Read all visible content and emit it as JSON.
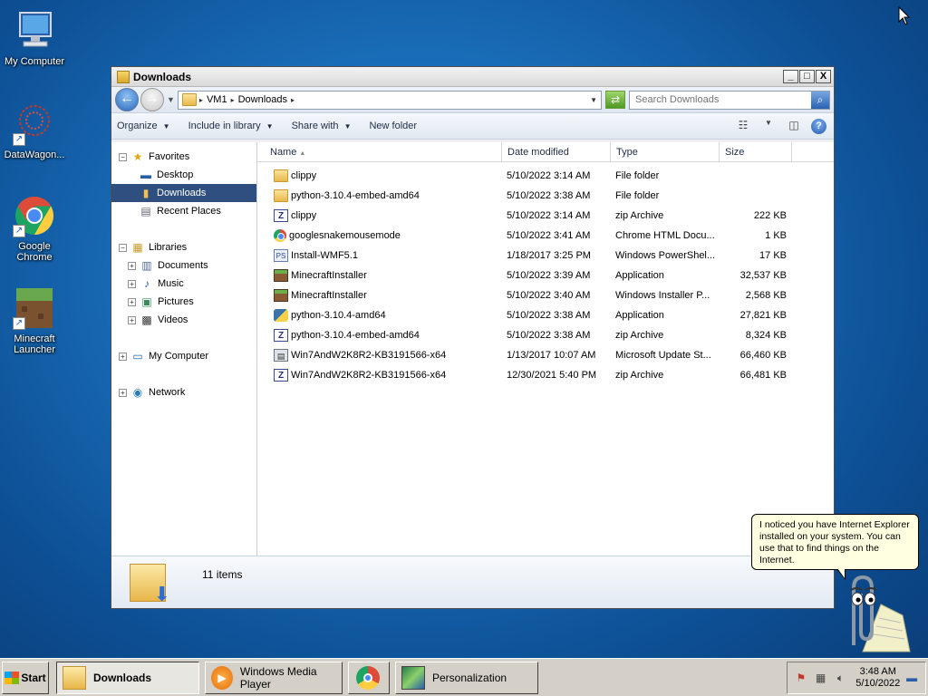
{
  "desktop": {
    "icons": [
      {
        "label": "My Computer"
      },
      {
        "label": "DataWagon..."
      },
      {
        "label": "Google Chrome"
      },
      {
        "label": "Minecraft Launcher"
      }
    ]
  },
  "window": {
    "title": "Downloads",
    "minimize": "_",
    "maximize": "□",
    "close": "X"
  },
  "address": {
    "segments": [
      "VM1",
      "Downloads"
    ],
    "search_placeholder": "Search Downloads"
  },
  "toolbar": {
    "organize": "Organize",
    "include": "Include in library",
    "share": "Share with",
    "new_folder": "New folder"
  },
  "nav": {
    "favorites": "Favorites",
    "desktop": "Desktop",
    "downloads": "Downloads",
    "recent": "Recent Places",
    "libraries": "Libraries",
    "documents": "Documents",
    "music": "Music",
    "pictures": "Pictures",
    "videos": "Videos",
    "computer": "My Computer",
    "network": "Network"
  },
  "columns": {
    "name": "Name",
    "date": "Date modified",
    "type": "Type",
    "size": "Size"
  },
  "files": [
    {
      "name": "clippy",
      "date": "5/10/2022 3:14 AM",
      "type": "File folder",
      "size": "",
      "icon": "folder-icon"
    },
    {
      "name": "python-3.10.4-embed-amd64",
      "date": "5/10/2022 3:38 AM",
      "type": "File folder",
      "size": "",
      "icon": "folder-icon"
    },
    {
      "name": "clippy",
      "date": "5/10/2022 3:14 AM",
      "type": "zip Archive",
      "size": "222 KB",
      "icon": "zip-icon"
    },
    {
      "name": "googlesnakemousemode",
      "date": "5/10/2022 3:41 AM",
      "type": "Chrome HTML Docu...",
      "size": "1 KB",
      "icon": "chrome-html-icon"
    },
    {
      "name": "Install-WMF5.1",
      "date": "1/18/2017 3:25 PM",
      "type": "Windows PowerShel...",
      "size": "17 KB",
      "icon": "powershell-script-icon"
    },
    {
      "name": "MinecraftInstaller",
      "date": "5/10/2022 3:39 AM",
      "type": "Application",
      "size": "32,537 KB",
      "icon": "minecraft-icon"
    },
    {
      "name": "MinecraftInstaller",
      "date": "5/10/2022 3:40 AM",
      "type": "Windows Installer P...",
      "size": "2,568 KB",
      "icon": "msi-icon"
    },
    {
      "name": "python-3.10.4-amd64",
      "date": "5/10/2022 3:38 AM",
      "type": "Application",
      "size": "27,821 KB",
      "icon": "python-icon"
    },
    {
      "name": "python-3.10.4-embed-amd64",
      "date": "5/10/2022 3:38 AM",
      "type": "zip Archive",
      "size": "8,324 KB",
      "icon": "zip-icon"
    },
    {
      "name": "Win7AndW2K8R2-KB3191566-x64",
      "date": "1/13/2017 10:07 AM",
      "type": "Microsoft Update St...",
      "size": "66,460 KB",
      "icon": "msu-icon"
    },
    {
      "name": "Win7AndW2K8R2-KB3191566-x64",
      "date": "12/30/2021 5:40 PM",
      "type": "zip Archive",
      "size": "66,481 KB",
      "icon": "zip-icon"
    }
  ],
  "details": {
    "count": "11 items"
  },
  "clippy": {
    "message": "I noticed you have Internet Explorer installed on your system. You can use that to find things on the Internet."
  },
  "taskbar": {
    "start": "Start",
    "tasks": [
      {
        "label": "Downloads"
      },
      {
        "label": "Windows Media Player"
      },
      {
        "label": ""
      },
      {
        "label": "Personalization"
      }
    ],
    "time": "3:48 AM",
    "date": "5/10/2022"
  }
}
